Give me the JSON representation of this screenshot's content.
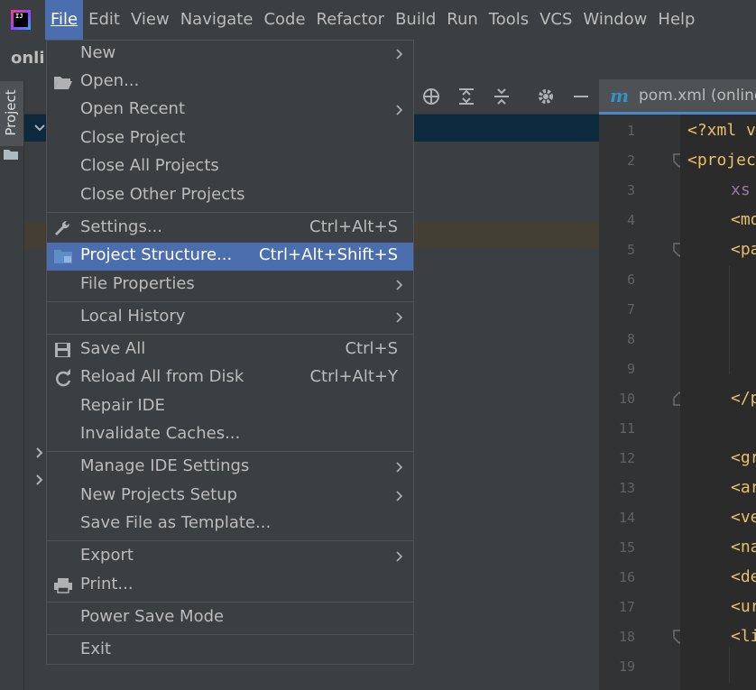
{
  "menubar": {
    "logo_text": "IJ",
    "items": [
      "File",
      "Edit",
      "View",
      "Navigate",
      "Code",
      "Refactor",
      "Build",
      "Run",
      "Tools",
      "VCS",
      "Window",
      "Help"
    ]
  },
  "navbar": {
    "project_crumb": "onli"
  },
  "sidebar": {
    "project_tab": "Project"
  },
  "editor": {
    "tab_icon": "m",
    "tab_label": "pom.xml (online",
    "line_numbers": [
      "1",
      "2",
      "3",
      "4",
      "5",
      "6",
      "7",
      "8",
      "9",
      "10",
      "11",
      "12",
      "13",
      "14",
      "15",
      "16",
      "17",
      "18",
      "19"
    ],
    "code_lines": [
      "<?xml v",
      "<projec",
      "xs",
      "<mo",
      "<pa",
      "</p",
      "<gr",
      "<ar",
      "<ve",
      "<na",
      "<de",
      "<ur",
      "<li"
    ]
  },
  "file_menu": {
    "items": [
      {
        "label": "New",
        "shortcut": "",
        "submenu": true
      },
      {
        "label": "Open...",
        "shortcut": "",
        "submenu": false
      },
      {
        "label": "Open Recent",
        "shortcut": "",
        "submenu": true
      },
      {
        "label": "Close Project",
        "shortcut": "",
        "submenu": false
      },
      {
        "label": "Close All Projects",
        "shortcut": "",
        "submenu": false
      },
      {
        "label": "Close Other Projects",
        "shortcut": "",
        "submenu": false
      },
      {
        "label": "Settings...",
        "shortcut": "Ctrl+Alt+S",
        "submenu": false
      },
      {
        "label": "Project Structure...",
        "shortcut": "Ctrl+Alt+Shift+S",
        "submenu": false,
        "selected": true
      },
      {
        "label": "File Properties",
        "shortcut": "",
        "submenu": true
      },
      {
        "label": "Local History",
        "shortcut": "",
        "submenu": true
      },
      {
        "label": "Save All",
        "shortcut": "Ctrl+S",
        "submenu": false
      },
      {
        "label": "Reload All from Disk",
        "shortcut": "Ctrl+Alt+Y",
        "submenu": false
      },
      {
        "label": "Repair IDE",
        "shortcut": "",
        "submenu": false
      },
      {
        "label": "Invalidate Caches...",
        "shortcut": "",
        "submenu": false
      },
      {
        "label": "Manage IDE Settings",
        "shortcut": "",
        "submenu": true
      },
      {
        "label": "New Projects Setup",
        "shortcut": "",
        "submenu": true
      },
      {
        "label": "Save File as Template...",
        "shortcut": "",
        "submenu": false
      },
      {
        "label": "Export",
        "shortcut": "",
        "submenu": true
      },
      {
        "label": "Print...",
        "shortcut": "",
        "submenu": false
      },
      {
        "label": "Power Save Mode",
        "shortcut": "",
        "submenu": false
      },
      {
        "label": "Exit",
        "shortcut": "",
        "submenu": false
      }
    ]
  },
  "colors": {
    "menu_bg": "#3c3f41",
    "selection": "#4b6eaf",
    "editor_bg": "#2b2b2b",
    "xml_tag": "#e8bf6a"
  },
  "icons": [
    "folder-open-icon",
    "wrench-icon",
    "project-structure-icon",
    "save-icon",
    "reload-icon",
    "printer-icon",
    "chevron-right-icon",
    "crosshair-icon",
    "expand-all-icon",
    "collapse-all-icon",
    "gear-icon",
    "minimize-icon"
  ]
}
